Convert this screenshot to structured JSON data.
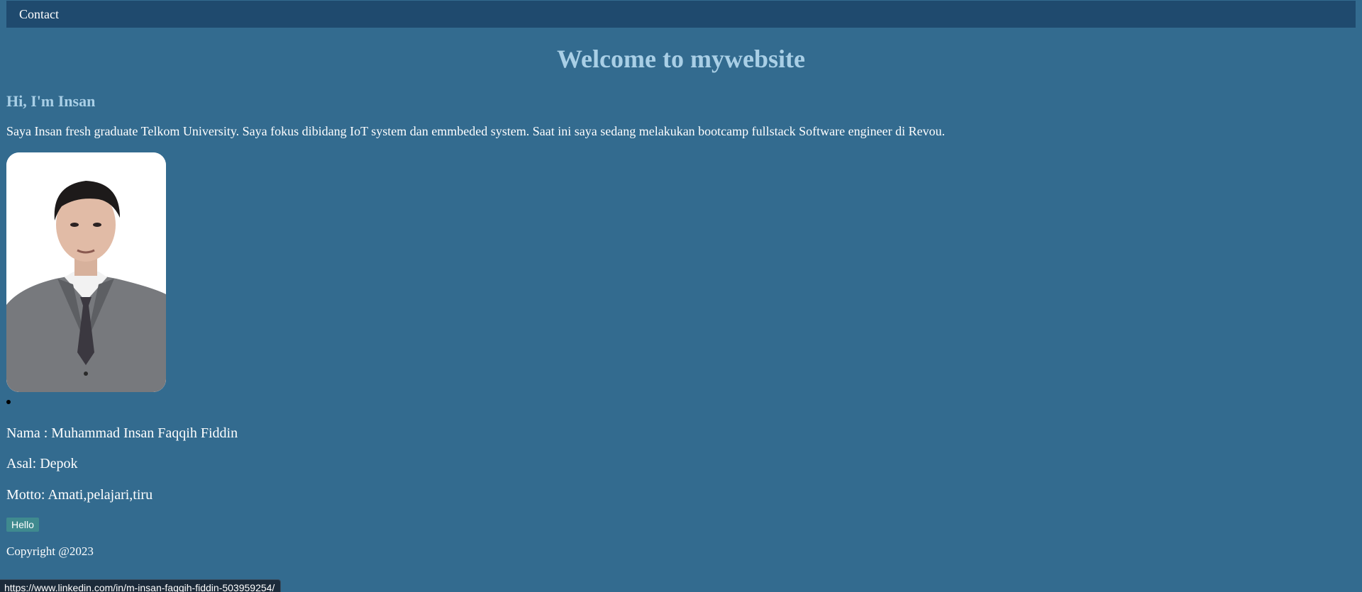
{
  "nav": {
    "items": [
      {
        "label": "Contact"
      }
    ]
  },
  "header": {
    "title": "Welcome to mywebsite"
  },
  "about": {
    "greeting": "Hi, I'm Insan",
    "intro": "Saya Insan fresh graduate Telkom University. Saya fokus dibidang IoT system dan emmbeded system. Saat ini saya sedang melakukan bootcamp fullstack Software engineer di Revou."
  },
  "profile": {
    "photo_icon": "profile-photo",
    "nama": "Nama : Muhammad Insan Faqqih Fiddin",
    "asal": "Asal: Depok",
    "motto": "Motto: Amati,pelajari,tiru"
  },
  "actions": {
    "hello_label": "Hello"
  },
  "footer": {
    "copyright": "Copyright @2023"
  },
  "status_bar": {
    "url": "https://www.linkedin.com/in/m-insan-faqqih-fiddin-503959254/"
  },
  "colors": {
    "background": "#336b8f",
    "navbar": "#1f4a6e",
    "heading": "#a9cfe6",
    "button": "#3f8a8f"
  }
}
